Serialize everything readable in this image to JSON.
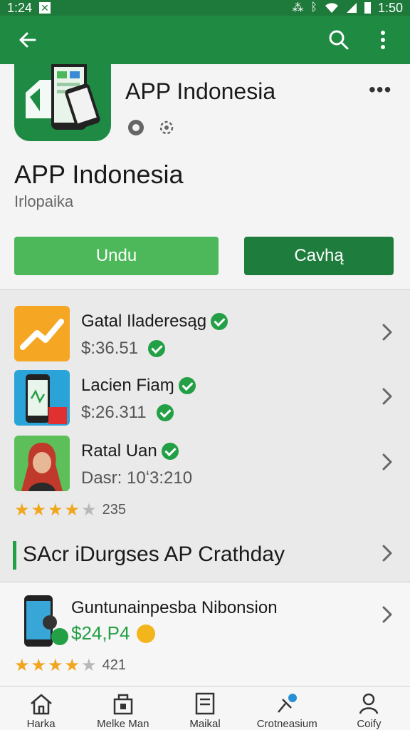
{
  "status_bar": {
    "time_left": "1:24",
    "time_right": "1:50"
  },
  "header": {
    "app_title": "APP Indonesia",
    "more_label": "•••",
    "big_title": "APP Indonesia",
    "subtitle": "Irlopaika",
    "download_label": "Undu",
    "secondary_label": "Cavhą"
  },
  "list": {
    "items": [
      {
        "name": "Gatal Iladeresąg",
        "price": "$:36.51"
      },
      {
        "name": "Lacien Fiaɱ",
        "price": "$:26.311"
      },
      {
        "name": "Ratal Uan",
        "price": "Dasr: 10ʻ3:210"
      }
    ],
    "rating": {
      "stars": 4,
      "count": "235"
    },
    "section_label": "SAcr iDurgses AP Crathday"
  },
  "featured": {
    "name": "Guntunainpesba Nibonsion",
    "price": "$24,P4",
    "rating": {
      "stars": 4,
      "count": "421"
    }
  },
  "bottom_nav": [
    {
      "label": "Harka",
      "icon": "home-icon"
    },
    {
      "label": "Melke Man",
      "icon": "store-icon"
    },
    {
      "label": "Maikal",
      "icon": "list-icon"
    },
    {
      "label": "Crotneasium",
      "icon": "pin-icon"
    },
    {
      "label": "Coify",
      "icon": "person-icon"
    }
  ],
  "colors": {
    "primary": "#1f8a42",
    "accent": "#4cb85a",
    "star": "#f0a61d"
  }
}
